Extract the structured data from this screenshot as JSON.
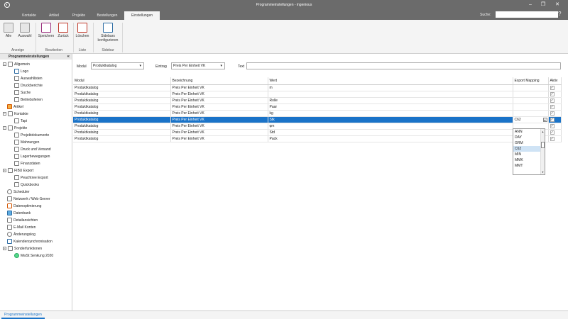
{
  "window": {
    "title": "Programmeinstellungen - ingenious",
    "logo": "ingenious-logo"
  },
  "tabs": [
    {
      "label": "Kontakte"
    },
    {
      "label": "Artikel"
    },
    {
      "label": "Projekte"
    },
    {
      "label": "Bestellungen"
    },
    {
      "label": "Einstellungen"
    }
  ],
  "search": {
    "label": "Suche:",
    "placeholder": ""
  },
  "ribbon": {
    "alle": "Alle",
    "auswahl": "Auswahl",
    "anzeige": "Anzeige",
    "speichern": "Speichern",
    "zurueck": "Zurück",
    "bearbeiten": "Bearbeiten",
    "loeschen": "Löschen",
    "liste": "Liste",
    "sidebar_btn": "Sidebars konfigurieren",
    "sidebar_group": "Sidebar"
  },
  "sidebar": {
    "title": "Programmeinstellungen",
    "items": [
      {
        "label": "Allgemein"
      },
      {
        "label": "Logo"
      },
      {
        "label": "Auswahllisten"
      },
      {
        "label": "Druckberichte"
      },
      {
        "label": "Suche"
      },
      {
        "label": "Betriebsferien"
      },
      {
        "label": "Artikel"
      },
      {
        "label": "Kontakte"
      },
      {
        "label": "Tapi"
      },
      {
        "label": "Projekte"
      },
      {
        "label": "Projektdokumente"
      },
      {
        "label": "Mahnungen"
      },
      {
        "label": "Druck und Versand"
      },
      {
        "label": "Lagerbewegungen"
      },
      {
        "label": "Finanzdaten"
      },
      {
        "label": "FIBU Export"
      },
      {
        "label": "Peachtree Export"
      },
      {
        "label": "Quickbooks"
      },
      {
        "label": "Scheduler"
      },
      {
        "label": "Netzwerk / Web-Server"
      },
      {
        "label": "Datenoptimierung"
      },
      {
        "label": "Datenbank"
      },
      {
        "label": "Detailansichten"
      },
      {
        "label": "E-Mail Konten"
      },
      {
        "label": "Änderungslog"
      },
      {
        "label": "Kalendersynchronisation"
      },
      {
        "label": "Sonderfunktionen"
      },
      {
        "label": "MwSt Senkung 2020"
      }
    ]
  },
  "filters": {
    "modul_label": "Modul",
    "modul_value": "Produktkatalog",
    "eintrag_label": "Eintrag",
    "eintrag_value": "Preis Per Einheit VK",
    "text_label": "Text"
  },
  "grid": {
    "headers": [
      "Modul",
      "Bezeichnung",
      "Wert",
      "Export Mapping",
      "Aktiv"
    ],
    "rows": [
      {
        "modul": "Produktkatalog",
        "bez": "Preis Per Einheit VK",
        "wert": "m",
        "map": ""
      },
      {
        "modul": "Produktkatalog",
        "bez": "Preis Per Einheit VK",
        "wert": "",
        "map": ""
      },
      {
        "modul": "Produktkatalog",
        "bez": "Preis Per Einheit VK",
        "wert": "Rolle",
        "map": ""
      },
      {
        "modul": "Produktkatalog",
        "bez": "Preis Per Einheit VK",
        "wert": "Paar",
        "map": ""
      },
      {
        "modul": "Produktkatalog",
        "bez": "Preis Per Einheit VK",
        "wert": "kg",
        "map": ""
      },
      {
        "modul": "Produktkatalog",
        "bez": "Preis Per Einheit VK",
        "wert": "Stk",
        "map": "C62"
      },
      {
        "modul": "Produktkatalog",
        "bez": "Preis Per Einheit VK",
        "wert": "qm",
        "map": ""
      },
      {
        "modul": "Produktkatalog",
        "bez": "Preis Per Einheit VK",
        "wert": "Std",
        "map": ""
      },
      {
        "modul": "Produktkatalog",
        "bez": "Preis Per Einheit VK",
        "wert": "Pack",
        "map": ""
      }
    ],
    "selected_row": 5
  },
  "dropdown": {
    "options": [
      "ANN",
      "DAY",
      "GRM",
      "C62",
      "MIN",
      "MMK",
      "MMT"
    ],
    "highlighted": "C62"
  },
  "statusbar": {
    "tab": "Programmeinstellungen"
  }
}
